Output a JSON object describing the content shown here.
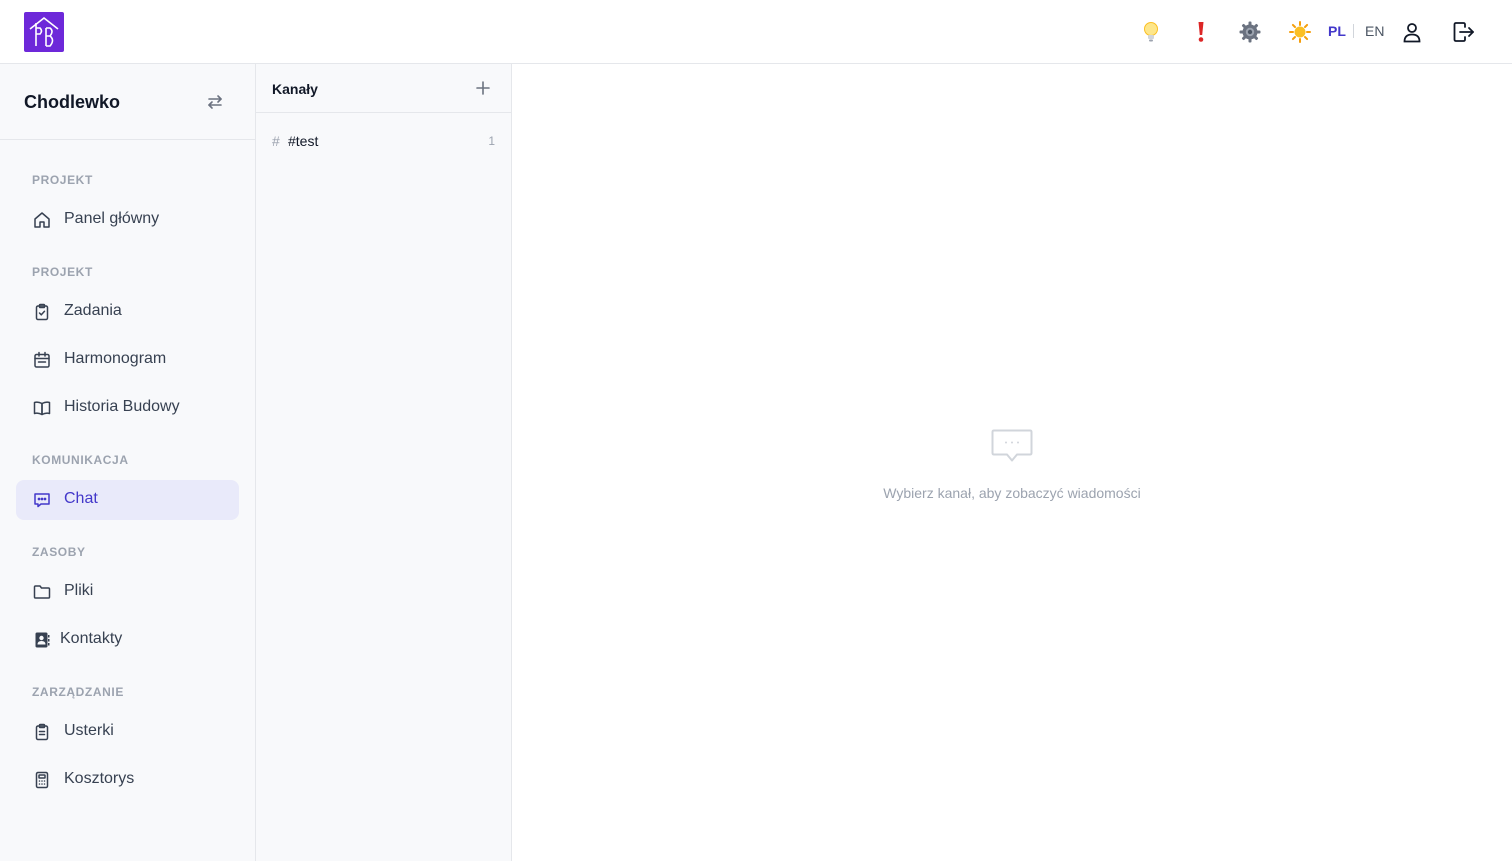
{
  "header": {
    "logo_text": "PB",
    "icons": [
      "lightbulb-icon",
      "exclamation-icon",
      "gear-icon",
      "sun-icon",
      "user-icon",
      "logout-icon"
    ],
    "languages": {
      "active": "PL",
      "inactive": "EN"
    }
  },
  "sidebar": {
    "project_name": "Chodlewko",
    "sections": [
      {
        "label": "PROJEKT",
        "items": [
          {
            "label": "Panel główny",
            "icon": "home-icon"
          }
        ]
      },
      {
        "label": "PROJEKT",
        "items": [
          {
            "label": "Zadania",
            "icon": "clipboard-check-icon"
          },
          {
            "label": "Harmonogram",
            "icon": "calendar-icon"
          },
          {
            "label": "Historia Budowy",
            "icon": "book-icon"
          }
        ]
      },
      {
        "label": "KOMUNIKACJA",
        "items": [
          {
            "label": "Chat",
            "icon": "chat-icon",
            "active": true
          }
        ]
      },
      {
        "label": "ZASOBY",
        "items": [
          {
            "label": "Pliki",
            "icon": "folder-icon"
          },
          {
            "label": "Kontakty",
            "icon": "contact-book-icon"
          }
        ]
      },
      {
        "label": "ZARZĄDZANIE",
        "items": [
          {
            "label": "Usterki",
            "icon": "clipboard-list-icon"
          },
          {
            "label": "Kosztorys",
            "icon": "calculator-icon"
          }
        ]
      }
    ]
  },
  "channels": {
    "title": "Kanały",
    "items": [
      {
        "hash": "#",
        "name": "#test",
        "count": "1"
      }
    ]
  },
  "main": {
    "empty_message": "Wybierz kanał, aby zobaczyć wiadomości"
  },
  "colors": {
    "accent": "#4338ca",
    "logo": "#6d28d9",
    "active_bg": "#e9eafa"
  }
}
